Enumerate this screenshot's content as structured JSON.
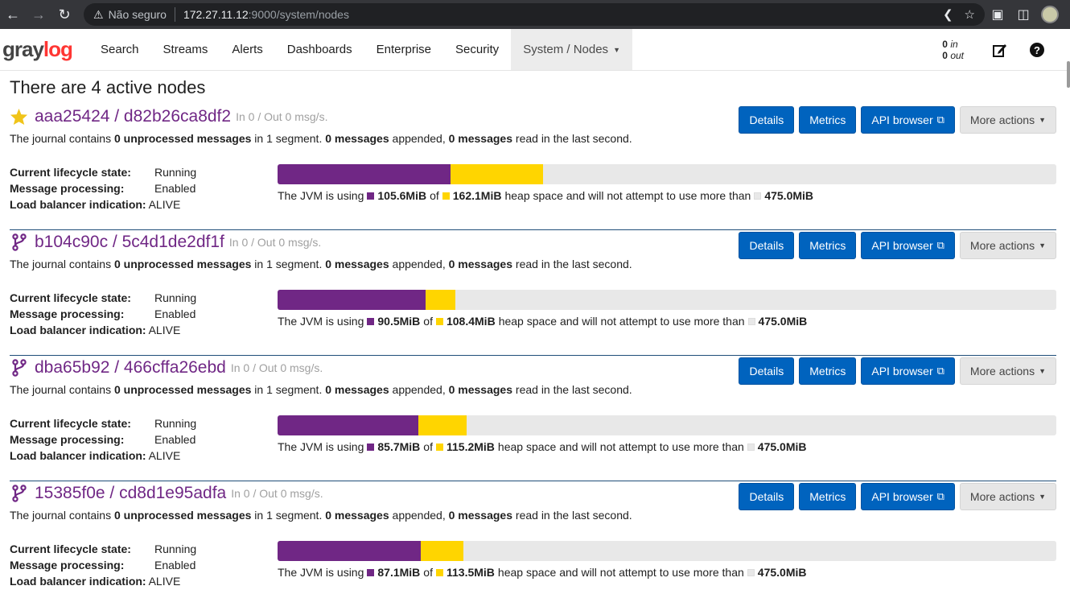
{
  "browser": {
    "insecure_label": "Não seguro",
    "url_host": "172.27.11.12",
    "url_path": ":9000/system/nodes"
  },
  "navbar": {
    "logo": {
      "gray": "gray",
      "log": "log"
    },
    "items": [
      {
        "label": "Search"
      },
      {
        "label": "Streams"
      },
      {
        "label": "Alerts"
      },
      {
        "label": "Dashboards"
      },
      {
        "label": "Enterprise"
      },
      {
        "label": "Security"
      },
      {
        "label": "System / Nodes"
      }
    ],
    "throughput": {
      "in_value": "0",
      "in_label": "in",
      "out_value": "0",
      "out_label": "out"
    }
  },
  "page": {
    "title": "There are 4 active nodes"
  },
  "labels": {
    "details": "Details",
    "metrics": "Metrics",
    "api_browser": "API browser",
    "more_actions": "More actions",
    "lifecycle": "Current lifecycle state:",
    "processing": "Message processing:",
    "lb": "Load balancer indication:",
    "journal_1": "The journal contains",
    "journal_unprocessed": "0 unprocessed messages",
    "journal_2": "in 1 segment.",
    "journal_appended": "0 messages",
    "journal_3": "appended,",
    "journal_read": "0 messages",
    "journal_4": "read in the last second.",
    "jvm_1": "The JVM is using",
    "jvm_of": "of",
    "jvm_2": "heap space and will not attempt to use more than"
  },
  "colors": {
    "used": "#702785",
    "committed": "#ffd500",
    "max": "#e8e8e8",
    "primary": "#0063be"
  },
  "nodes": [
    {
      "name": "aaa25424 / d82b26ca8df2",
      "rate": "In 0 / Out 0 msg/s.",
      "icon": "star-icon",
      "lifecycle": "Running",
      "processing": "Enabled",
      "lb": "ALIVE",
      "used": "105.6MiB",
      "committed": "162.1MiB",
      "max": "475.0MiB",
      "used_mib": 105.6,
      "committed_mib": 162.1,
      "max_mib": 475.0
    },
    {
      "name": "b104c90c / 5c4d1de2df1f",
      "rate": "In 0 / Out 0 msg/s.",
      "icon": "code-fork-icon",
      "lifecycle": "Running",
      "processing": "Enabled",
      "lb": "ALIVE",
      "used": "90.5MiB",
      "committed": "108.4MiB",
      "max": "475.0MiB",
      "used_mib": 90.5,
      "committed_mib": 108.4,
      "max_mib": 475.0
    },
    {
      "name": "dba65b92 / 466cffa26ebd",
      "rate": "In 0 / Out 0 msg/s.",
      "icon": "code-fork-icon",
      "lifecycle": "Running",
      "processing": "Enabled",
      "lb": "ALIVE",
      "used": "85.7MiB",
      "committed": "115.2MiB",
      "max": "475.0MiB",
      "used_mib": 85.7,
      "committed_mib": 115.2,
      "max_mib": 475.0
    },
    {
      "name": "15385f0e / cd8d1e95adfa",
      "rate": "In 0 / Out 0 msg/s.",
      "icon": "code-fork-icon",
      "lifecycle": "Running",
      "processing": "Enabled",
      "lb": "ALIVE",
      "used": "87.1MiB",
      "committed": "113.5MiB",
      "max": "475.0MiB",
      "used_mib": 87.1,
      "committed_mib": 113.5,
      "max_mib": 475.0
    }
  ]
}
